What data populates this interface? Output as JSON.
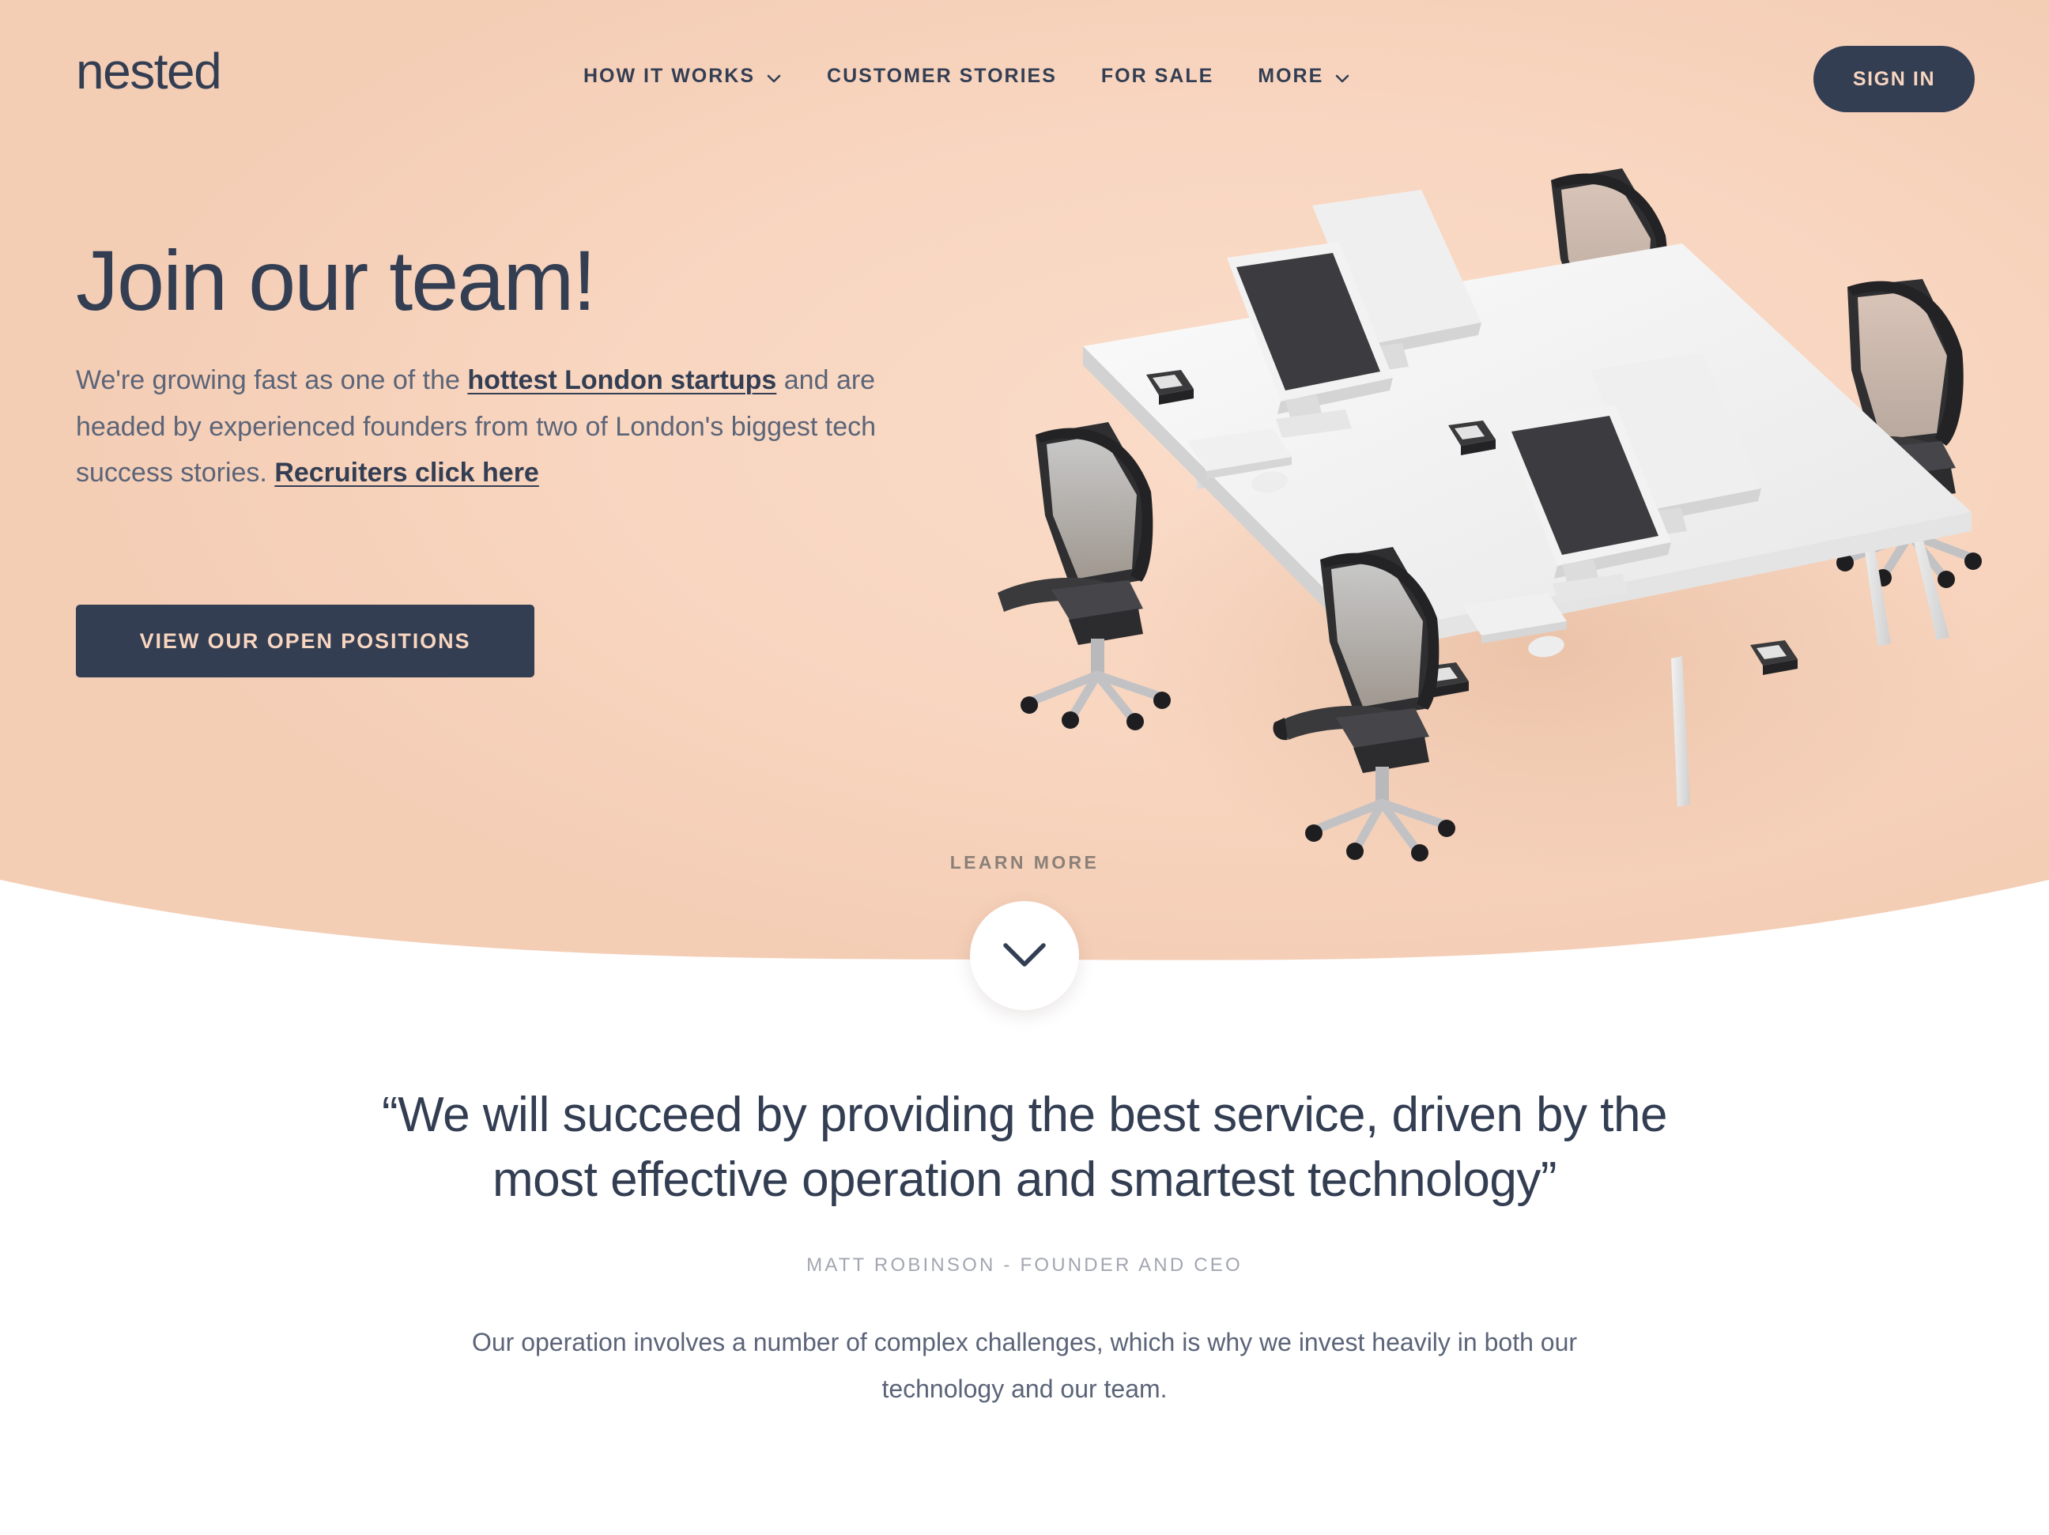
{
  "colors": {
    "peach": "#f8d5bf",
    "peach_deep": "#f2c4aa",
    "navy": "#333e53",
    "body_text": "#5b6478",
    "muted": "#a3a6b1",
    "learn_more_text": "#8b8079",
    "white": "#ffffff"
  },
  "header": {
    "logo": "nested",
    "nav": [
      {
        "label": "HOW IT WORKS",
        "has_dropdown": true,
        "icon": "chevron-down-icon"
      },
      {
        "label": "CUSTOMER STORIES",
        "has_dropdown": false,
        "icon": ""
      },
      {
        "label": "FOR SALE",
        "has_dropdown": false,
        "icon": ""
      },
      {
        "label": "MORE",
        "has_dropdown": true,
        "icon": "chevron-down-icon"
      }
    ],
    "sign_in_label": "SIGN IN"
  },
  "hero": {
    "title": "Join our team!",
    "paragraph": {
      "part1": "We're growing fast as one of the ",
      "link1": "hottest London startups",
      "part2": " and are headed by experienced founders from two of London's biggest tech success stories. ",
      "link2": "Recruiters click here"
    },
    "cta_label": "VIEW OUR OPEN POSITIONS",
    "illustration_alt": "isometric office desk with four monitors and four mesh office chairs"
  },
  "scroll": {
    "learn_more_label": "LEARN MORE",
    "chevron_icon": "chevron-down-icon"
  },
  "quote_section": {
    "quote": "“We will succeed by providing the best service, driven by the most effective operation and smartest technology”",
    "author": "MATT ROBINSON - FOUNDER AND CEO",
    "body": "Our operation involves a number of complex challenges, which is why we invest heavily in both our technology and our team."
  }
}
